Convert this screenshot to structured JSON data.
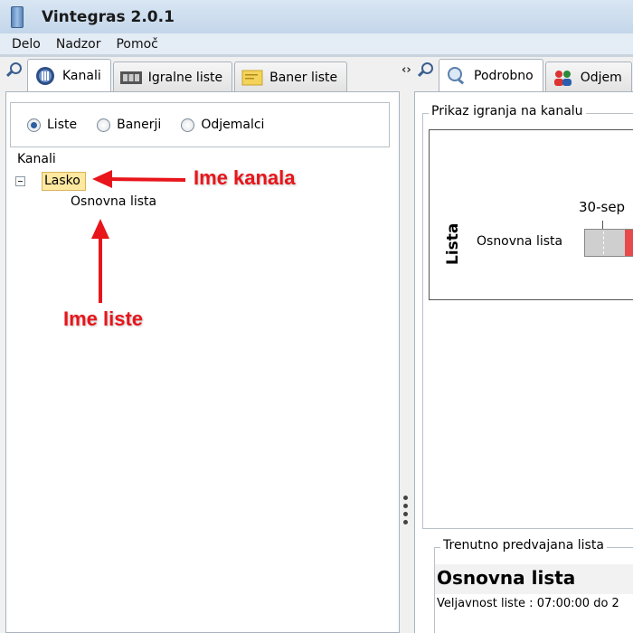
{
  "window": {
    "title": "Vintegras 2.0.1"
  },
  "menu": [
    "Delo",
    "Nadzor",
    "Pomoč"
  ],
  "left_tabs": [
    {
      "label": "Kanali",
      "icon": "channels-icon",
      "active": true
    },
    {
      "label": "Igralne liste",
      "icon": "film-icon",
      "active": false
    },
    {
      "label": "Baner liste",
      "icon": "note-icon",
      "active": false
    }
  ],
  "right_tabs": [
    {
      "label": "Podrobno",
      "icon": "magnifier-icon",
      "active": true
    },
    {
      "label": "Odjem",
      "icon": "users-icon",
      "active": false
    }
  ],
  "filter": {
    "options": [
      {
        "label": "Liste",
        "selected": true
      },
      {
        "label": "Banerji",
        "selected": false
      },
      {
        "label": "Odjemalci",
        "selected": false
      }
    ]
  },
  "tree": {
    "header": "Kanali",
    "channel": "Lasko",
    "list": "Osnovna lista"
  },
  "annotations": {
    "channel_name": "Ime kanala",
    "list_name": "Ime liste"
  },
  "playback": {
    "group_title": "Prikaz igranja na kanalu",
    "y_label": "Lista",
    "row_label": "Osnovna lista",
    "date_tick": "30-sep"
  },
  "current": {
    "group_title": "Trenutno predvajana lista",
    "name": "Osnovna lista",
    "validity": "Veljavnost liste : 07:00:00 do 2"
  },
  "colors": {
    "bar_gray": "#cfcfcf",
    "bar_red": "#e64a4a",
    "annotation_red": "#e8151b",
    "selected_node": "#ffe8a0"
  }
}
